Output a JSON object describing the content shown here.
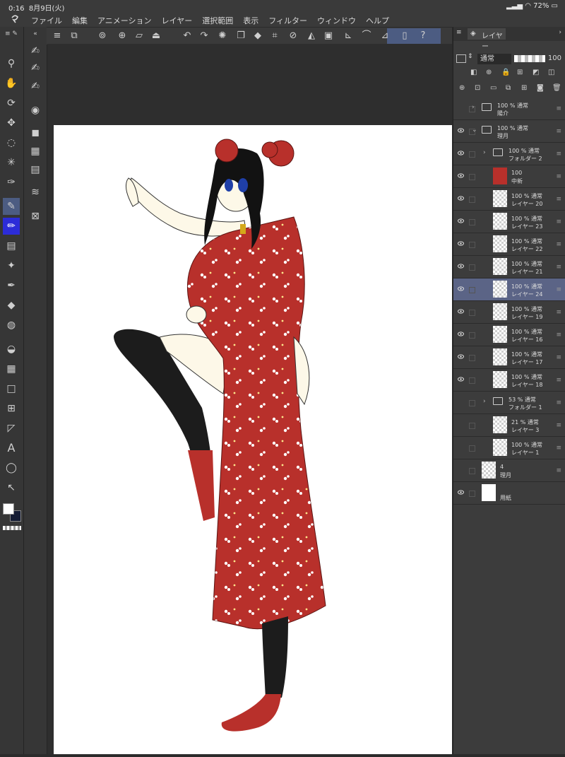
{
  "status": {
    "time": "0:16",
    "date": "8月9日(火)",
    "battery": "72%"
  },
  "menu": [
    "ファイル",
    "編集",
    "アニメーション",
    "レイヤー",
    "選択範囲",
    "表示",
    "フィルター",
    "ウィンドウ",
    "ヘルプ"
  ],
  "panel": {
    "tab_label": "レイヤー",
    "blend_mode": "通常",
    "opacity": "100",
    "layers": [
      {
        "kind": "folder",
        "collapsed": true,
        "line1": "100 % 通常",
        "line2": "陽介"
      },
      {
        "kind": "folder",
        "collapsed": false,
        "line1": "100 % 通常",
        "line2": "理月"
      },
      {
        "kind": "folder",
        "collapsed": true,
        "line1": "100 % 通常",
        "line2": "フォルダー 2"
      },
      {
        "kind": "mask",
        "line1": "100",
        "line2": "中新"
      },
      {
        "kind": "raster",
        "line1": "100 % 通常",
        "line2": "レイヤー 20"
      },
      {
        "kind": "raster",
        "line1": "100 % 通常",
        "line2": "レイヤー 23"
      },
      {
        "kind": "raster",
        "line1": "100 % 通常",
        "line2": "レイヤー 22"
      },
      {
        "kind": "raster",
        "line1": "100 % 通常",
        "line2": "レイヤー 21"
      },
      {
        "kind": "raster",
        "line1": "100 % 通常",
        "line2": "レイヤー 24",
        "selected": true
      },
      {
        "kind": "raster",
        "line1": "100 % 通常",
        "line2": "レイヤー 19"
      },
      {
        "kind": "raster",
        "line1": "100 % 通常",
        "line2": "レイヤー 16"
      },
      {
        "kind": "raster",
        "line1": "100 % 通常",
        "line2": "レイヤー 17"
      },
      {
        "kind": "raster",
        "line1": "100 % 通常",
        "line2": "レイヤー 18"
      },
      {
        "kind": "folder",
        "collapsed": true,
        "line1": "53 % 通常",
        "line2": "フォルダー 1"
      },
      {
        "kind": "raster",
        "line1": "21 % 通常",
        "line2": "レイヤー 3"
      },
      {
        "kind": "raster",
        "line1": "100 % 通常",
        "line2": "レイヤー 1"
      },
      {
        "kind": "ref",
        "line1": "4",
        "line2": "理月"
      },
      {
        "kind": "paper",
        "line1": "",
        "line2": "用紙"
      }
    ]
  },
  "colors": {
    "accent": "#4c5c82",
    "selected_layer": "#5b6486",
    "dress": "#b8302b",
    "stocking": "#1c1c1c",
    "skin": "#fdf8e8"
  }
}
